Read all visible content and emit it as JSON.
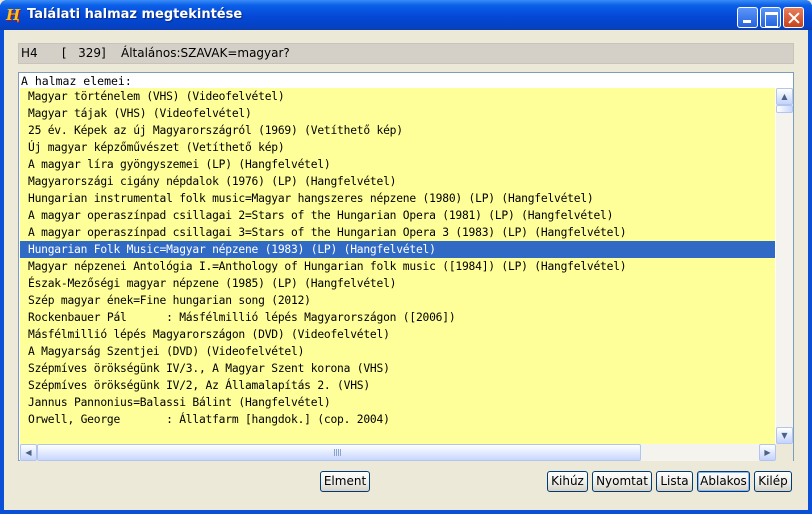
{
  "window": {
    "title": "Találati halmaz megtekintése",
    "icon": "app-logo-icon"
  },
  "query": {
    "set_id": "H4",
    "count": "[   329]",
    "expression": "Általános:SZAVAK=magyar?"
  },
  "list": {
    "header": "A halmaz elemei:",
    "selected_index": 9,
    "items": [
      "Magyar történelem (VHS) (Videofelvétel)",
      "Magyar tájak (VHS) (Videofelvétel)",
      "25 év. Képek az új Magyarországról (1969) (Vetíthető kép)",
      "Új magyar képzőművészet (Vetíthető kép)",
      "A magyar líra gyöngyszemei (LP) (Hangfelvétel)",
      "Magyarországi cigány népdalok (1976) (LP) (Hangfelvétel)",
      "Hungarian instrumental folk music=Magyar hangszeres népzene (1980) (LP) (Hangfelvétel)",
      "A magyar operaszínpad csillagai 2=Stars of the Hungarian Opera (1981) (LP) (Hangfelvétel)",
      "A magyar operaszínpad csillagai 3=Stars of the Hungarian Opera 3 (1983) (LP) (Hangfelvétel)",
      "Hungarian Folk Music=Magyar népzene (1983) (LP) (Hangfelvétel)",
      "Magyar népzenei Antológia I.=Anthology of Hungarian folk music ([1984]) (LP) (Hangfelvétel)",
      "Észak-Mezőségi magyar népzene (1985) (LP) (Hangfelvétel)",
      "Szép magyar ének=Fine hungarian song (2012)",
      "Rockenbauer Pál      : Másfélmillió lépés Magyarországon ([2006])",
      "Másfélmillió lépés Magyarországon (DVD) (Videofelvétel)",
      "A Magyarság Szentjei (DVD) (Videofelvétel)",
      "Szépmíves örökségünk IV/3., A Magyar Szent korona (VHS)",
      "Szépmíves örökségünk IV/2, Az Államalapítás 2. (VHS)",
      "Jannus Pannonius=Balassi Bálint (Hangfelvétel)",
      "Orwell, George       : Állatfarm [hangdok.] (cop. 2004)"
    ]
  },
  "buttons": {
    "save": "Elment",
    "export": "Kihúz",
    "print": "Nyomtat",
    "list": "Lista",
    "windowed": "Ablakos",
    "exit": "Kilép"
  },
  "scroll": {
    "up_arrow": "▲",
    "down_arrow": "▼",
    "left_arrow": "◀",
    "right_arrow": "▶"
  },
  "colors": {
    "list_background": "#ffff99",
    "selection": "#316ac5",
    "titlebar": "#0548d6"
  }
}
